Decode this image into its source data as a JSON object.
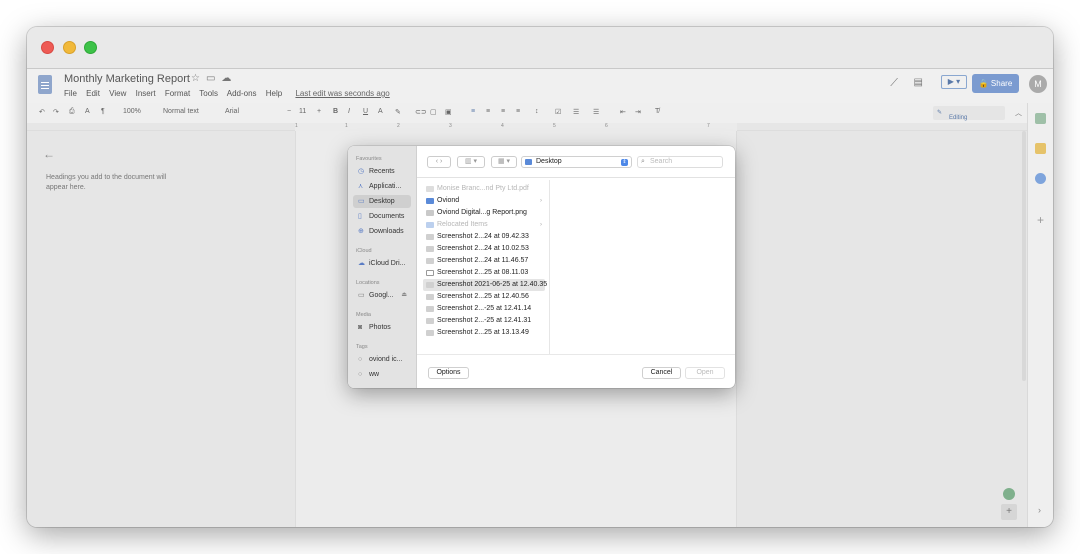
{
  "doc": {
    "title": "Monthly Marketing Report",
    "menu": [
      "File",
      "Edit",
      "View",
      "Insert",
      "Format",
      "Tools",
      "Add-ons",
      "Help"
    ],
    "last_edit": "Last edit was seconds ago",
    "share_label": "Share",
    "avatar_initial": "M"
  },
  "toolbar": {
    "zoom": "100%",
    "style": "Normal text",
    "font": "Arial",
    "font_size": "11",
    "editing_label": "Editing"
  },
  "ruler": [
    "1",
    "1",
    "2",
    "3",
    "4",
    "5",
    "6",
    "7"
  ],
  "outline": {
    "hint": "Headings you add to the document will appear here."
  },
  "dialog": {
    "sidebar": {
      "favourites_label": "Favourites",
      "favourites": [
        "Recents",
        "Applicati...",
        "Desktop",
        "Documents",
        "Downloads"
      ],
      "icloud_label": "iCloud",
      "icloud": [
        "iCloud Dri..."
      ],
      "locations_label": "Locations",
      "locations": [
        "Googl..."
      ],
      "media_label": "Media",
      "media": [
        "Photos"
      ],
      "tags_label": "Tags",
      "tags": [
        "oviond ic...",
        "ww"
      ]
    },
    "location": "Desktop",
    "search_placeholder": "Search",
    "files": [
      "Monise Branc...nd Pty Ltd.pdf",
      "Oviond",
      "Oviond Digital...g Report.png",
      "Relocated Items",
      "Screenshot 2...24 at 09.42.33",
      "Screenshot 2...24 at 10.02.53",
      "Screenshot 2...24 at 11.46.57",
      "Screenshot 2...25 at 08.11.03",
      "Screenshot 2021-06-25 at 12.40.35",
      "Screenshot 2...25 at 12.40.56",
      "Screenshot 2...-25 at 12.41.14",
      "Screenshot 2...-25 at 12.41.31",
      "Screenshot 2...25 at 13.13.49"
    ],
    "options_label": "Options",
    "cancel_label": "Cancel",
    "open_label": "Open"
  }
}
